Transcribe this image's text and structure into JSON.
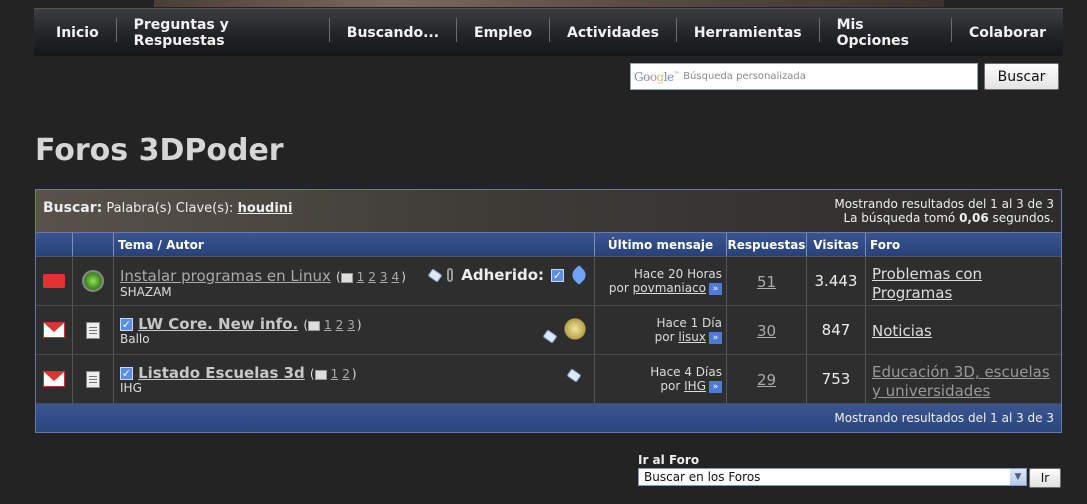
{
  "nav": {
    "items": [
      {
        "label": "Inicio"
      },
      {
        "label": "Preguntas y Respuestas"
      },
      {
        "label": "Buscando..."
      },
      {
        "label": "Empleo"
      },
      {
        "label": "Actividades"
      },
      {
        "label": "Herramientas"
      },
      {
        "label": "Mis Opciones"
      },
      {
        "label": "Colaborar"
      }
    ]
  },
  "search": {
    "logo": "Google",
    "placeholder": "Búsqueda personalizada",
    "button": "Buscar"
  },
  "page": {
    "title": "Foros 3DPoder"
  },
  "results": {
    "search_label": "Buscar:",
    "keyword_label": "Palabra(s) Clave(s):",
    "keyword": "houdini",
    "showing": "Mostrando resultados del 1 al 3 de 3",
    "took_prefix": "La búsqueda tomó",
    "took_value": "0,06",
    "took_suffix": "segundos.",
    "columns": {
      "topic": "Tema / Autor",
      "last": "Último mensaje",
      "replies": "Respuestas",
      "views": "Visitas",
      "forum": "Foro"
    },
    "rows": [
      {
        "title": "Instalar programas en Linux",
        "pages": [
          "1",
          "2",
          "3",
          "4"
        ],
        "author": "SHAZAM",
        "sticky_label": "Adherido:",
        "last_time": "Hace 20 Horas",
        "last_by": "por",
        "last_user": "povmaniaco",
        "replies": "51",
        "views": "3.443",
        "forum": "Problemas con Programas"
      },
      {
        "title": "LW Core. New info.",
        "pages": [
          "1",
          "2",
          "3"
        ],
        "author": "Ballo",
        "last_time": "Hace 1 Día",
        "last_by": "por",
        "last_user": "lisux",
        "replies": "30",
        "views": "847",
        "forum": "Noticias"
      },
      {
        "title": "Listado Escuelas 3d",
        "pages": [
          "1",
          "2"
        ],
        "author": "IHG",
        "last_time": "Hace 4 Días",
        "last_by": "por",
        "last_user": "IHG",
        "replies": "29",
        "views": "753",
        "forum": "Educación 3D, escuelas y universidades"
      }
    ],
    "footer": "Mostrando resultados del 1 al 3 de 3"
  },
  "goto": {
    "label": "Ir al Foro",
    "selected": "Buscar en los Foros",
    "button": "Ir"
  }
}
